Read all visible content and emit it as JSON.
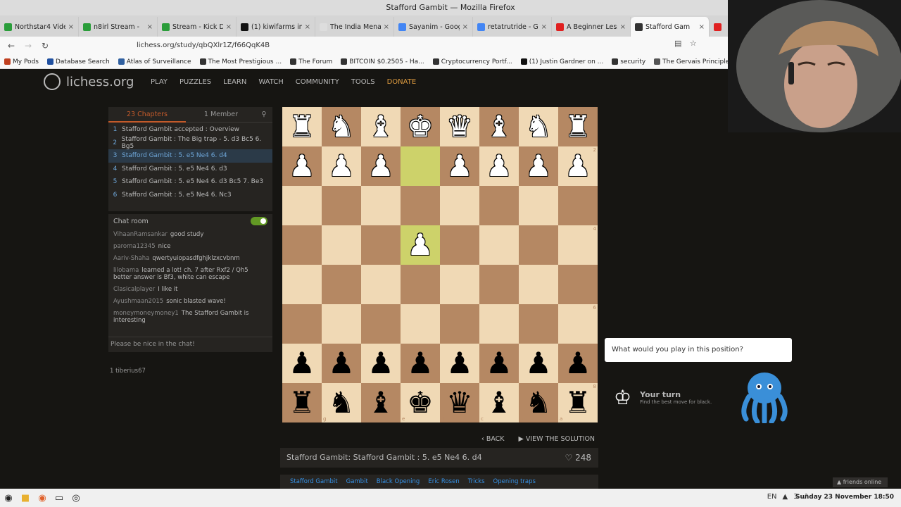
{
  "window": {
    "title": "Stafford Gambit — Mozilla Firefox"
  },
  "tabs": [
    {
      "label": "Northstar4 Video",
      "color": "#2a9d3a"
    },
    {
      "label": "n8irl Stream -",
      "color": "#2a9d3a"
    },
    {
      "label": "Stream - Kick Dast",
      "color": "#2a9d3a"
    },
    {
      "label": "(1) kiwifarms india",
      "color": "#111111"
    },
    {
      "label": "The India Menace | Pa",
      "color": "#dddddd"
    },
    {
      "label": "Sayanim - Google S",
      "color": "#4285f4"
    },
    {
      "label": "retatrutride - Goo",
      "color": "#4285f4"
    },
    {
      "label": "A Beginner Lesson",
      "color": "#e02020"
    },
    {
      "label": "Stafford Gam",
      "color": "#333333",
      "active": true
    },
    {
      "label": "",
      "color": "#e02020"
    }
  ],
  "url": "lichess.org/study/qbQXlr1Z/f66QqK4B",
  "bookmarks": [
    {
      "label": "My Pods",
      "color": "#c04020"
    },
    {
      "label": "Database Search",
      "color": "#2050a0"
    },
    {
      "label": "Atlas of Surveillance",
      "color": "#3060a0"
    },
    {
      "label": "The Most Prestigious ...",
      "color": "#333333"
    },
    {
      "label": "The Forum",
      "color": "#333333"
    },
    {
      "label": "BITCOIN $0.2505 - Ha...",
      "color": "#333333"
    },
    {
      "label": "Cryptocurrency Portf...",
      "color": "#333333"
    },
    {
      "label": "(1) Justin Gardner on ...",
      "color": "#111111"
    },
    {
      "label": "security",
      "color": "#333333"
    },
    {
      "label": "The Gervais Principle,...",
      "color": "#555555"
    },
    {
      "label": "Z-Library - the",
      "color": "#333333"
    }
  ],
  "site": {
    "logo": "lichess.org",
    "nav": [
      "PLAY",
      "PUZZLES",
      "LEARN",
      "WATCH",
      "COMMUNITY",
      "TOOLS",
      "DONATE"
    ]
  },
  "chapters": {
    "tab_chapters": "23 Chapters",
    "tab_members": "1 Member",
    "items": [
      {
        "n": "1",
        "label": "Stafford Gambit accepted : Overview"
      },
      {
        "n": "2",
        "label": "Stafford Gambit : The Big trap - 5. d3 Bc5 6. Bg5"
      },
      {
        "n": "3",
        "label": "Stafford Gambit : 5. e5 Ne4 6. d4",
        "active": true
      },
      {
        "n": "4",
        "label": "Stafford Gambit : 5. e5 Ne4 6. d3"
      },
      {
        "n": "5",
        "label": "Stafford Gambit : 5. e5 Ne4 6. d3 Bc5 7. Be3"
      },
      {
        "n": "6",
        "label": "Stafford Gambit : 5. e5 Ne4 6. Nc3"
      }
    ]
  },
  "chat": {
    "title": "Chat room",
    "messages": [
      {
        "user": "VihaanRamsankar",
        "text": "good study"
      },
      {
        "user": "paroma12345",
        "text": "nice"
      },
      {
        "user": "Aariv-Shaha",
        "text": "qwertyuiopasdfghjklzxcvbnm"
      },
      {
        "user": "lilobama",
        "text": "learned a lot! ch. 7 after Rxf2 / Qh5 better answer is Bf3, white can escape"
      },
      {
        "user": "Clasicalplayer",
        "text": "I like it"
      },
      {
        "user": "Ayushmaan2015",
        "text": "sonic blasted wave!"
      },
      {
        "user": "moneymoneymoney1",
        "text": "The Stafford Gambit is interesting"
      }
    ],
    "input_placeholder": "Please be nice in the chat!"
  },
  "members": "1 tiberius67",
  "board": {
    "orientation": "black",
    "rows": [
      [
        "wR",
        "wN",
        "wB",
        "wK",
        "wQ",
        "wB",
        "wN",
        "wR"
      ],
      [
        "wP",
        "wP",
        "wP",
        "",
        "wP",
        "wP",
        "wP",
        "wP"
      ],
      [
        "",
        "",
        "",
        "",
        "",
        "",
        "",
        ""
      ],
      [
        "",
        "",
        "",
        "wP",
        "",
        "",
        "",
        ""
      ],
      [
        "",
        "",
        "",
        "",
        "",
        "",
        "",
        ""
      ],
      [
        "",
        "",
        "",
        "",
        "",
        "",
        "",
        ""
      ],
      [
        "bP",
        "bP",
        "bP",
        "bP",
        "bP",
        "bP",
        "bP",
        "bP"
      ],
      [
        "bR",
        "bN",
        "bB",
        "bK",
        "bQ",
        "bB",
        "bN",
        "bR"
      ]
    ],
    "highlight": [
      [
        1,
        3
      ],
      [
        3,
        3
      ]
    ],
    "rank_labels": [
      "1",
      "2",
      "3",
      "4",
      "5",
      "6",
      "7",
      "8"
    ],
    "file_labels": [
      "h",
      "g",
      "f",
      "e",
      "d",
      "c",
      "b",
      "a"
    ]
  },
  "controls": {
    "back": "BACK",
    "solution": "VIEW THE SOLUTION"
  },
  "game_title": "Stafford Gambit: Stafford Gambit : 5. e5 Ne4 6. d4",
  "likes": "248",
  "tags": [
    "Stafford Gambit",
    "Gambit",
    "Black Opening",
    "Eric Rosen",
    "Tricks",
    "Opening traps"
  ],
  "prompt": {
    "question": "What would you play in this position?",
    "turn": "Your turn",
    "hint": "Find the best move for black."
  },
  "friends": "friends online",
  "taskbar": {
    "lang": "EN",
    "clock": "Sunday 23 November 18:50",
    "tray_num": "3"
  }
}
